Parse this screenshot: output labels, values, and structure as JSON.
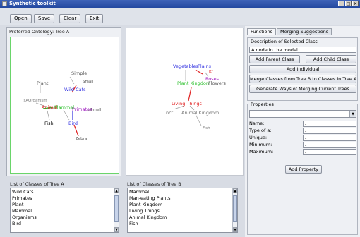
{
  "window": {
    "title": "Synthetic toolkit",
    "controls": [
      "_",
      "□",
      "×"
    ]
  },
  "toolbar": {
    "open": "Open",
    "save": "Save",
    "clear": "Clear",
    "exit": "Exit"
  },
  "left_panel": {
    "title": "Preferred Ontology: Tree A"
  },
  "tree_a": {
    "nodes": {
      "simple": "Simple",
      "plant": "Plant",
      "small": "Small",
      "wild_cats": "Wild Cats",
      "ungroup": "isAOrganism",
      "animal": "Animal",
      "mammal": "Mammal",
      "primates": "Primates",
      "smell": "Smell",
      "fish": "Fish",
      "bird": "Bird",
      "zebra": "Zebra"
    },
    "colors": {
      "red": "#e02020",
      "green": "#2ec02e",
      "blue": "#3030e0",
      "purple": "#a020c0",
      "gray": "#777777"
    }
  },
  "tree_b": {
    "nodes": {
      "vegetables": "Vegetables",
      "plains": "Plains",
      "kf": "Kf",
      "roses": "Roses",
      "plant_kingdom": "Plant Kingdom",
      "flowers": "Flowers",
      "living_things": "Living Things",
      "nct": "nct",
      "animal_kingdom": "Animal Kingdom",
      "fish": "Fish"
    }
  },
  "list_a": {
    "title": "List of Classes of Tree A",
    "items": [
      "Wild Cats",
      "Primates",
      "Plant",
      "Mammal",
      "Organisms",
      "Bird"
    ]
  },
  "list_b": {
    "title": "List of Classes of Tree B",
    "items": [
      "Mammal",
      "Man-eating Plants",
      "Plant Kingdom",
      "Living Things",
      "Animal Kingdom",
      "Fish"
    ]
  },
  "right_panel": {
    "tabs": [
      "Functions",
      "Merging Suggestions"
    ],
    "description_legend": "Description of Selected Class",
    "description_value": "A node in the model",
    "add_parent": "Add Parent Class",
    "add_child": "Add Child Class",
    "add_individual": "Add Individual",
    "merge_classes": "Merge Classes from Tree B to Classes in Tree A",
    "generate_ways": "Generate Ways of Merging Current Trees",
    "properties_legend": "Properties",
    "fields": {
      "name_label": "Name:",
      "name_value": "-",
      "type_label": "Type of a:",
      "type_value": "-",
      "unique_label": "Unique:",
      "unique_value": "-",
      "minimum_label": "Minimum:",
      "minimum_value": "-",
      "maximum_label": "Maximum:",
      "maximum_value": "-"
    },
    "add_property": "Add Property"
  }
}
